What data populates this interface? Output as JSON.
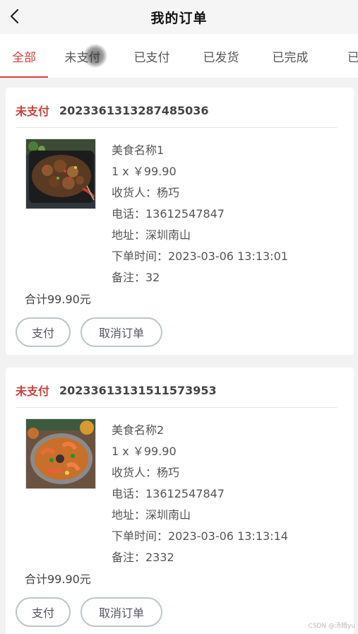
{
  "header": {
    "title": "我的订单",
    "back_icon": "chevron-left-icon"
  },
  "tabs": [
    {
      "label": "全部",
      "active": true
    },
    {
      "label": "未支付",
      "active": false
    },
    {
      "label": "已支付",
      "active": false
    },
    {
      "label": "已发货",
      "active": false
    },
    {
      "label": "已完成",
      "active": false
    },
    {
      "label": "已取",
      "active": false
    }
  ],
  "orders": [
    {
      "status": "未支付",
      "order_no": "2023361313287485036",
      "name": "美食名称1",
      "qty_price": "1 x ￥99.90",
      "receiver": "收货人：杨巧",
      "phone": "电话：13612547847",
      "address": "地址：深圳南山",
      "time": "下单时间：2023-03-06 13:13:01",
      "note": "备注：32",
      "total": "合计99.90元",
      "pay_label": "支付",
      "cancel_label": "取消订单"
    },
    {
      "status": "未支付",
      "order_no": "20233613131511573953",
      "name": "美食名称2",
      "qty_price": "1 x ￥99.90",
      "receiver": "收货人：杨巧",
      "phone": "电话：13612547847",
      "address": "地址：深圳南山",
      "time": "下单时间：2023-03-06 13:13:14",
      "note": "备注：2332",
      "total": "合计99.90元",
      "pay_label": "支付",
      "cancel_label": "取消订单"
    }
  ],
  "watermark": "CSDN @汤姆yu",
  "colors": {
    "accent": "#d63f3f",
    "status": "#c9403a",
    "button_border": "#b8c7c9"
  }
}
